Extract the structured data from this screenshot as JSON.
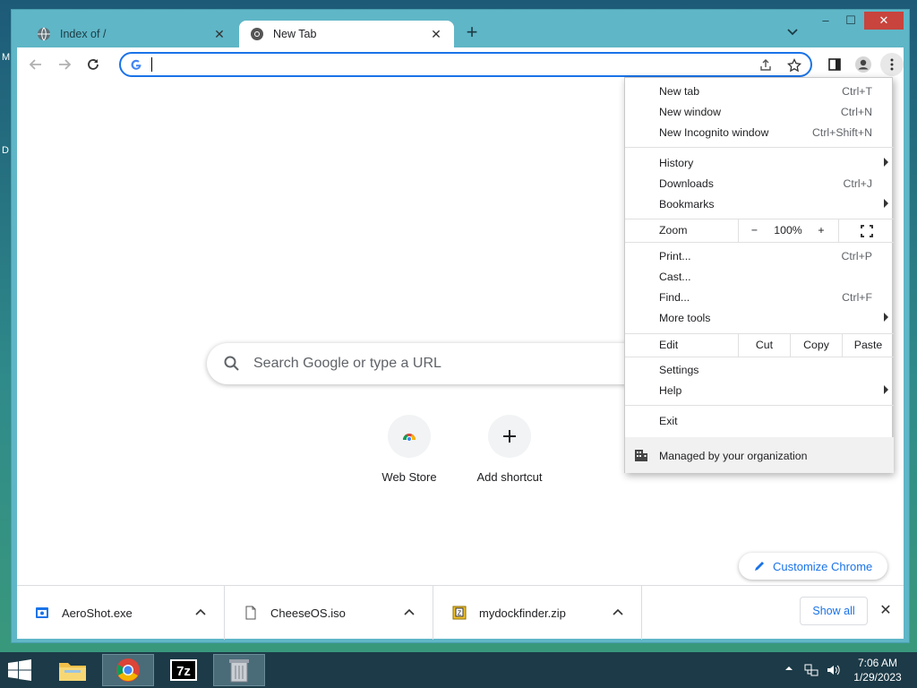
{
  "desktop": {
    "edge_letters": [
      "M",
      "D"
    ]
  },
  "window": {
    "tabs": [
      {
        "title": "Index of /",
        "favicon": "globe-icon",
        "active": false
      },
      {
        "title": "New Tab",
        "favicon": "chrome-icon",
        "active": true
      }
    ],
    "controls": {
      "minimize": "–",
      "maximize": "☐",
      "close": "✕"
    }
  },
  "toolbar": {
    "omnibox_value": "",
    "icons": [
      "back-icon",
      "forward-icon",
      "reload-icon",
      "share-icon",
      "star-icon",
      "side-panel-icon",
      "profile-icon",
      "kebab-menu-icon"
    ]
  },
  "ntp": {
    "search_placeholder": "Search Google or type a URL",
    "shortcuts": [
      {
        "label": "Web Store",
        "icon": "webstore-icon"
      },
      {
        "label": "Add shortcut",
        "icon": "plus-icon"
      }
    ],
    "customize_label": "Customize Chrome"
  },
  "menu": {
    "new_tab": {
      "label": "New tab",
      "shortcut": "Ctrl+T"
    },
    "new_window": {
      "label": "New window",
      "shortcut": "Ctrl+N"
    },
    "new_incognito": {
      "label": "New Incognito window",
      "shortcut": "Ctrl+Shift+N"
    },
    "history": {
      "label": "History"
    },
    "downloads": {
      "label": "Downloads",
      "shortcut": "Ctrl+J"
    },
    "bookmarks": {
      "label": "Bookmarks"
    },
    "zoom": {
      "label": "Zoom",
      "minus": "−",
      "value": "100%",
      "plus": "+"
    },
    "print": {
      "label": "Print...",
      "shortcut": "Ctrl+P"
    },
    "cast": {
      "label": "Cast..."
    },
    "find": {
      "label": "Find...",
      "shortcut": "Ctrl+F"
    },
    "more_tools": {
      "label": "More tools"
    },
    "edit": {
      "label": "Edit",
      "cut": "Cut",
      "copy": "Copy",
      "paste": "Paste"
    },
    "settings": {
      "label": "Settings"
    },
    "help": {
      "label": "Help"
    },
    "exit": {
      "label": "Exit"
    },
    "managed": {
      "label": "Managed by your organization"
    }
  },
  "downloads": {
    "items": [
      {
        "name": "AeroShot.exe",
        "icon": "exe-file-icon"
      },
      {
        "name": "CheeseOS.iso",
        "icon": "iso-file-icon"
      },
      {
        "name": "mydockfinder.zip",
        "icon": "zip-file-icon"
      }
    ],
    "show_all": "Show all"
  },
  "taskbar": {
    "items": [
      "file-explorer-icon",
      "chrome-icon",
      "7zip-icon",
      "recycle-app-icon"
    ],
    "time": "7:06 AM",
    "date": "1/29/2023"
  }
}
